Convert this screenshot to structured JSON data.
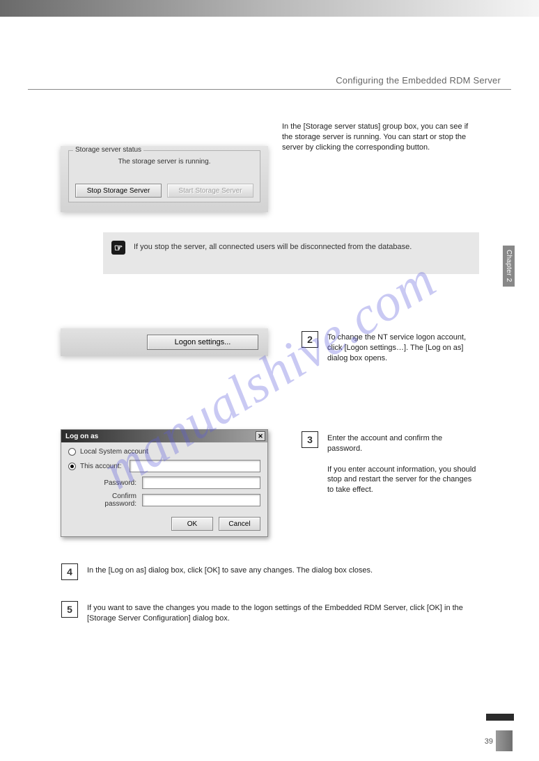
{
  "header": {
    "title": "Configuring the Embedded RDM Server"
  },
  "chapter": {
    "label": "Chapter 2"
  },
  "steps": {
    "s1": "In the [Storage server status] group box, you can see if the storage server is running. You can start or stop the server by clicking the corresponding button.",
    "s2": "To change the NT service logon account, click [Logon settings…]. The [Log on as] dialog box opens.",
    "s3_a": "Enter the account and confirm the password.",
    "s3_b": "If you enter account information, you should stop and restart the server for the changes to take effect.",
    "s4": "In the [Log on as] dialog box, click [OK] to save any changes. The dialog box closes.",
    "s5": "If you want to save the changes you made to the logon settings of the Embedded RDM Server, click [OK] in the [Storage Server Configuration] dialog box."
  },
  "panel1": {
    "legend": "Storage server status",
    "message": "The storage server is running.",
    "stop_btn": "Stop Storage Server",
    "start_btn": "Start Storage Server"
  },
  "note": {
    "text": "If you stop the server, all connected users will be disconnected from the database."
  },
  "panel2": {
    "logon_btn": "Logon settings..."
  },
  "dialog": {
    "title": "Log on as",
    "radio_local": "Local System account",
    "radio_this": "This account:",
    "lbl_password": "Password:",
    "lbl_confirm": "Confirm password:",
    "ok": "OK",
    "cancel": "Cancel"
  },
  "nums": {
    "n2": "2",
    "n3": "3",
    "n4": "4",
    "n5": "5"
  },
  "page": {
    "number": "39",
    "watermark": "manualshive.com"
  }
}
